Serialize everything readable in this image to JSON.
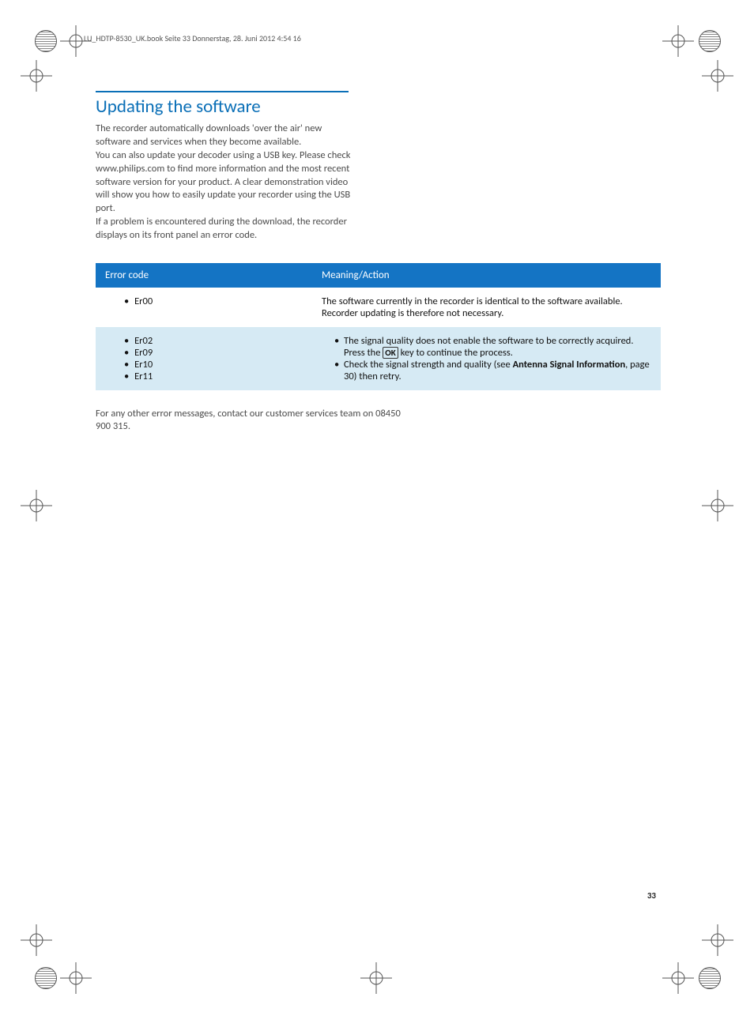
{
  "header_line": "LU_HDTP-8530_UK.book  Seite 33  Donnerstag, 28. Juni 2012  4:54 16",
  "section_title": "Updating the software",
  "intro_p1": "The recorder automatically downloads 'over the air' new software and services when they become available.",
  "intro_p2": "You can also update your decoder using a USB key. Please check www.philips.com to find more information and the most recent software version for your product. A clear demonstration video will show you how to easily update your recorder using the USB port.",
  "intro_p3": "If a problem is encountered during the download, the recorder displays on its front panel an error code.",
  "table": {
    "head_code": "Error code",
    "head_meaning": "Meaning/Action",
    "row1_code": "Er00",
    "row1_meaning": "The software currently in the recorder is identical to the software available. Recorder updating is therefore not necessary.",
    "row2_codes": [
      "Er02",
      "Er09",
      "Er10",
      "Er11"
    ],
    "row2_a_pre": "The signal quality does not enable the software to be correctly acquired. Press the ",
    "row2_a_key": "OK",
    "row2_a_post": " key to continue the process.",
    "row2_b_pre": "Check the signal strength and quality (see ",
    "row2_b_bold": "Antenna Signal Information",
    "row2_b_post": ", page 30) then retry."
  },
  "footer_note": "For any other error messages, contact our customer services team on 08450 900 315.",
  "page_number": "33"
}
